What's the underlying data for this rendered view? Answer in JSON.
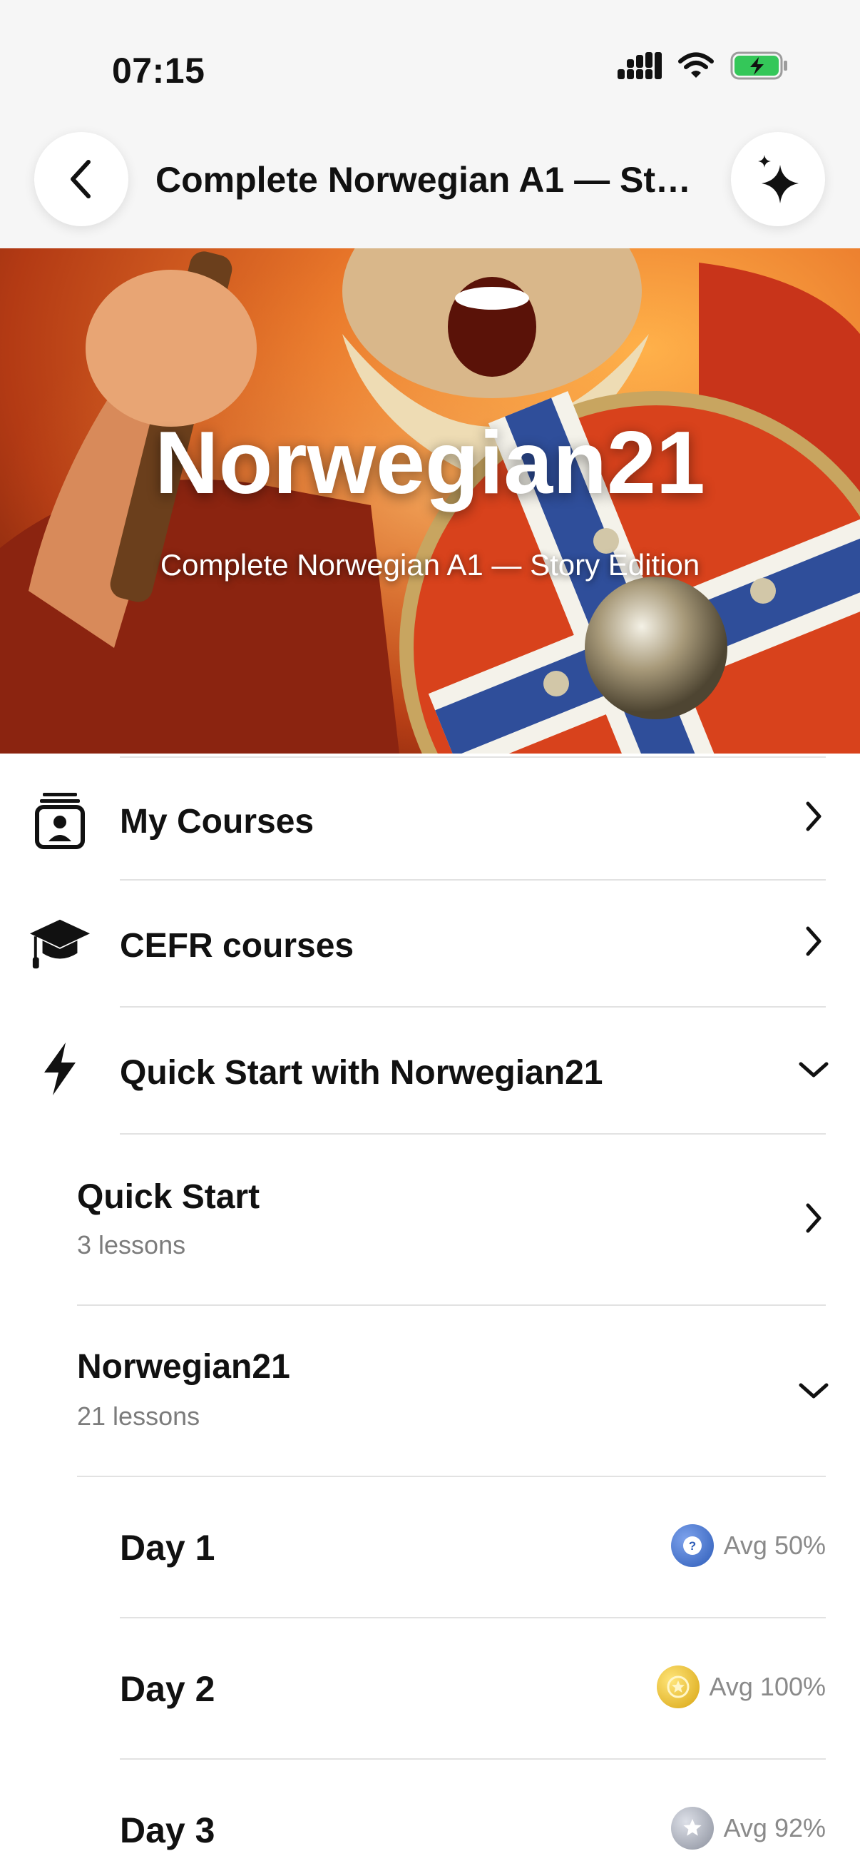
{
  "status": {
    "time": "07:15"
  },
  "nav": {
    "title": "Complete Norwegian A1 — Sto..."
  },
  "hero": {
    "title": "Norwegian21",
    "subtitle": "Complete Norwegian A1 — Story Edition"
  },
  "menu": [
    {
      "label": "My Courses",
      "icon": "contact-book-icon"
    },
    {
      "label": "CEFR courses",
      "icon": "graduation-cap-icon"
    },
    {
      "label": "Quick Start with Norwegian21",
      "icon": "lightning-bolt-icon"
    }
  ],
  "sections": [
    {
      "title": "Quick Start",
      "meta": "3 lessons"
    },
    {
      "title": "Norwegian21",
      "meta": "21 lessons"
    }
  ],
  "days": [
    {
      "label": "Day 1",
      "avg": "Avg 50%",
      "badge": "question-badge",
      "badge_color": "#3f6fc8"
    },
    {
      "label": "Day 2",
      "avg": "Avg 100%",
      "badge": "gold-star-badge",
      "badge_color": "#e6b820"
    },
    {
      "label": "Day 3",
      "avg": "Avg 92%",
      "badge": "silver-star-badge",
      "badge_color": "#a9adb8"
    }
  ]
}
